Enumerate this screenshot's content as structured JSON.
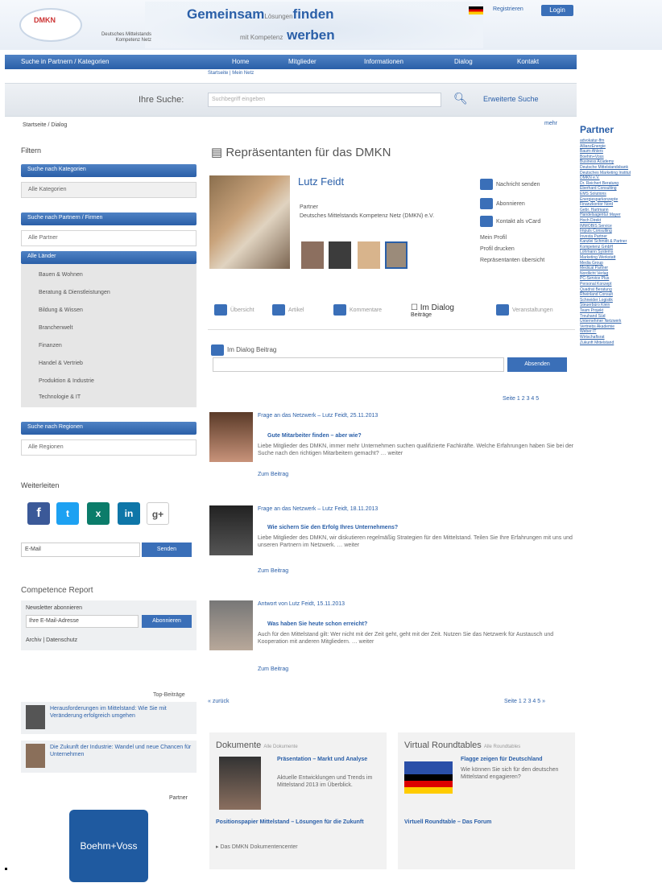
{
  "header": {
    "slogan1a": "Gemeinsam",
    "slogan1b": "Lösungen",
    "slogan1c": "finden",
    "slogan2a": "mit Kompetenz",
    "slogan2b": "werben",
    "org": "Deutsches Mittelstands Kompetenz Netz",
    "register": "Registrieren",
    "login": "Login"
  },
  "nav": {
    "items": [
      "Suche in Partnern / Kategorien",
      "Home",
      "Mitglieder",
      "Informationen",
      "Dialog",
      "Kontakt"
    ],
    "sub": "Startseite | Mein Netz"
  },
  "search": {
    "label": "Ihre Suche:",
    "placeholder": "Suchbegriff eingeben",
    "extended": "Erweiterte Suche"
  },
  "breadcrumb": "Startseite / Dialog",
  "more": "mehr",
  "sidebar": {
    "filter": "Filtern",
    "cat_box": "Suche nach Kategorien",
    "cat_select": "Alle Kategorien",
    "partner_box": "Suche nach Partnern / Firmen",
    "partner_input": "Alle Partner",
    "filter_head": "Alle Länder",
    "filters": [
      "Bauen & Wohnen",
      "Beratung & Dienstleistungen",
      "Bildung & Wissen",
      "Branchenwelt",
      "Finanzen",
      "Handel & Vertrieb",
      "Produktion & Industrie",
      "Technologie & IT"
    ],
    "region_box": "Suche nach Regionen",
    "region_input": "Alle Regionen",
    "network": "Weiterleiten",
    "email_ph": "E-Mail",
    "send": "Senden",
    "cr_head": "Competence Report",
    "cr_sub": "Newsletter abonnieren",
    "cr_input": "Ihre E-Mail-Adresse",
    "cr_btn": "Abonnieren",
    "cr_links": "Archiv | Datenschutz"
  },
  "main": {
    "title": "Repräsentanten für das DMKN",
    "person": "Lutz Feidt",
    "info": [
      "Partner",
      "Deutsches Mittelstands Kompetenz Netz (DMKN) e.V."
    ],
    "actions": [
      "Nachricht senden",
      "Abonnieren",
      "Kontakt als vCard"
    ],
    "links": [
      "Mein Profil",
      "Profil drucken",
      "Repräsentanten übersicht"
    ],
    "tabs": [
      "Übersicht",
      "Artikel",
      "Kommentare",
      "Im Dialog",
      "Veranstaltungen"
    ],
    "tab_active_sub": "Beiträge",
    "dialog": "Im Dialog Beitrag",
    "submit": "Absenden",
    "pages": "Seite 1 2 3 4 5",
    "feed": [
      {
        "meta": "Frage an das Netzwerk – Lutz Feidt, 25.11.2013",
        "title": "Gute Mitarbeiter finden – aber wie?",
        "text": "Liebe Mitglieder des DMKN, immer mehr Unternehmen suchen qualifizierte Fachkräfte. Welche Erfahrungen haben Sie bei der Suche nach den richtigen Mitarbeitern gemacht? … weiter",
        "link": "Zum Beitrag"
      },
      {
        "meta": "Frage an das Netzwerk – Lutz Feidt, 18.11.2013",
        "title": "Wie sichern Sie den Erfolg Ihres Unternehmens?",
        "text": "Liebe Mitglieder des DMKN, wir diskutieren regelmäßig Strategien für den Mittelstand. Teilen Sie Ihre Erfahrungen mit uns und unseren Partnern im Netzwerk. … weiter",
        "link": "Zum Beitrag"
      },
      {
        "meta": "Antwort von Lutz Feidt, 15.11.2013",
        "title": "Was haben Sie heute schon erreicht?",
        "text": "Auch für den Mittelstand gilt: Wer nicht mit der Zeit geht, geht mit der Zeit. Nutzen Sie das Netzwerk für Austausch und Kooperation mit anderen Mitgliedern. … weiter",
        "link": "Zum Beitrag"
      }
    ],
    "back": "« zurück",
    "next": "Seite 1 2 3 4 5 »"
  },
  "right": {
    "partner_head": "Partner",
    "partners": [
      "advokatur-ffm",
      "AllianzEnergie",
      "Baum-Ahlers",
      "Boehm+Voss",
      "Business Academy",
      "Deutsche Mittelstandsbank",
      "Deutsches Marketing Institut",
      "DMKN e.V.",
      "Dr. Reichert Beratung",
      "Eberhard Consulting",
      "EMS Solutions",
      "Energiesparkonzepte",
      "Finanzkontor Nord",
      "Gebr. Hartmann",
      "Handelsagentur Mayer",
      "Hoch Direkt",
      "IMMOBIS Service",
      "Impuls Consulting",
      "Investa Partner",
      "Kanzlei Schmidt & Partner",
      "Kompetenz GmbH",
      "Lohmann Systems",
      "Marketing Werkstatt",
      "Media Group",
      "Medical Partner",
      "Nordlicht Verlag",
      "PC-Service Plus",
      "Personal Konzept",
      "Quadrat Beratung",
      "Rheinland Consult",
      "Schneider Logistik",
      "Steuerbüro Klein",
      "Team Projekt",
      "Treuhand Süd",
      "Unternehmer Netzwerk",
      "Vertriebs Akademie",
      "Weber IT",
      "Wirtschaftsrat",
      "Zukunft Mittelstand"
    ]
  },
  "roundtables": {
    "head": "Top-Beiträge",
    "items": [
      "Herausforderungen im Mittelstand: Wie Sie mit Veränderung erfolgreich umgehen",
      "Die Zukunft der Industrie: Wandel und neue Chancen für Unternehmen"
    ],
    "partner_label": "Partner"
  },
  "docs": {
    "title": "Dokumente",
    "sub": "Alle Dokumente",
    "item_title": "Präsentation – Markt und Analyse",
    "item_text": "Aktuelle Entwicklungen und Trends im Mittelstand 2013 im Überblick.",
    "item_link": "Positionspapier Mittelstand – Lösungen für die Zukunft",
    "bullet": "Das DMKN Dokumentencenter"
  },
  "vr": {
    "title": "Virtual Roundtables",
    "sub": "Alle Roundtables",
    "item_title": "Flagge zeigen für Deutschland",
    "item_text": "Wie können Sie sich für den deutschen Mittelstand engagieren?",
    "link": "Virtuell Roundtable – Das Forum"
  },
  "boehm": "Boehm+Voss",
  "colors": {
    "brand": "#2a5fa8",
    "nav": "#3a6fb8"
  }
}
